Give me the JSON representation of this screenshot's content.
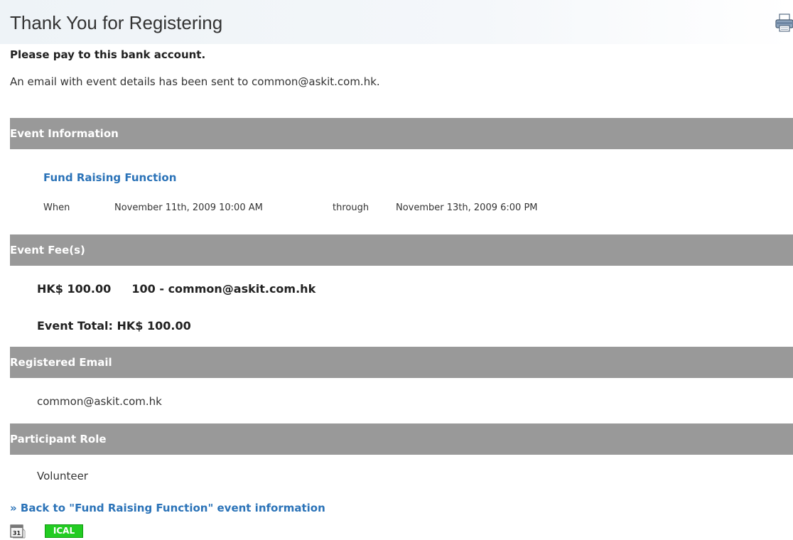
{
  "page": {
    "title": "Thank You for Registering",
    "pay_note": "Please pay to this bank account.",
    "email_note": "An email with event details has been sent to common@askit.com.hk."
  },
  "sections": {
    "event_info": {
      "header": "Event Information",
      "event_name": "Fund Raising Function",
      "when_label": "When",
      "start": "November 11th, 2009 10:00 AM",
      "through_label": "through",
      "end": "November 13th, 2009 6:00 PM"
    },
    "event_fees": {
      "header": "Event Fee(s)",
      "fee_amount": "HK$ 100.00",
      "fee_description": "100 - common@askit.com.hk",
      "total": "Event Total: HK$ 100.00"
    },
    "registered_email": {
      "header": "Registered Email",
      "value": "common@askit.com.hk"
    },
    "participant_role": {
      "header": "Participant Role",
      "value": "Volunteer"
    }
  },
  "footer": {
    "back_link": "» Back to \"Fund Raising Function\" event information",
    "calendar_icon_text": "31",
    "ical_label": "ICAL"
  },
  "icons": {
    "printer": "printer-icon",
    "calendar": "calendar-icon"
  },
  "colors": {
    "link": "#2b73b8",
    "section_header_bg": "#999999",
    "ical_green": "#22cc22"
  }
}
